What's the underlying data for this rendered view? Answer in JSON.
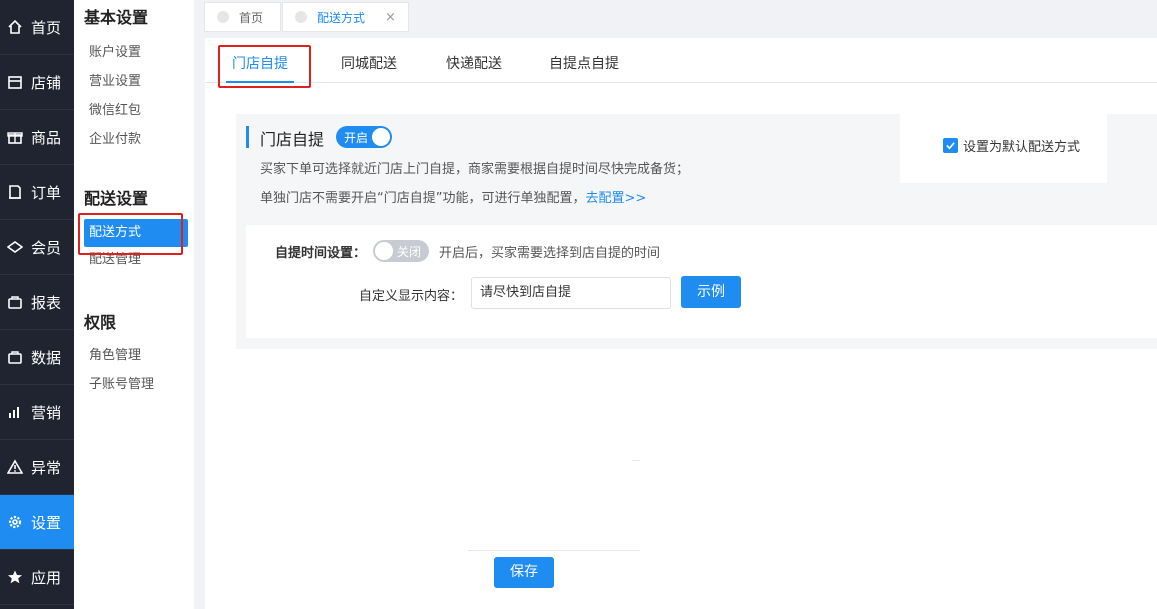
{
  "nav": {
    "items": [
      {
        "label": "首页",
        "icon": "home-icon"
      },
      {
        "label": "店铺",
        "icon": "store-icon"
      },
      {
        "label": "商品",
        "icon": "gift-icon"
      },
      {
        "label": "订单",
        "icon": "order-icon"
      },
      {
        "label": "会员",
        "icon": "member-icon"
      },
      {
        "label": "报表",
        "icon": "report-icon"
      },
      {
        "label": "数据",
        "icon": "data-icon"
      },
      {
        "label": "营销",
        "icon": "marketing-icon"
      },
      {
        "label": "异常",
        "icon": "warning-icon"
      },
      {
        "label": "设置",
        "icon": "gear-icon"
      },
      {
        "label": "应用",
        "icon": "star-icon"
      }
    ],
    "active_index": 9
  },
  "sidebar": {
    "groups": [
      {
        "title": "基本设置",
        "items": [
          "账户设置",
          "营业设置",
          "微信红包",
          "企业付款"
        ]
      },
      {
        "title": "配送设置",
        "items": [
          "配送方式",
          "配送管理"
        ]
      },
      {
        "title": "权限",
        "items": [
          "角色管理",
          "子账号管理"
        ]
      }
    ],
    "active_item": "配送方式"
  },
  "tabs": [
    {
      "label": "首页",
      "closable": false
    },
    {
      "label": "配送方式",
      "closable": true,
      "close_glyph": "×"
    }
  ],
  "subtabs": [
    "门店自提",
    "同城配送",
    "快递配送",
    "自提点自提"
  ],
  "panel": {
    "title": "门店自提",
    "switch_on_label": "开启",
    "desc1": "买家下单可选择就近门店上门自提，商家需要根据自提时间尽快完成备货；",
    "desc2": "单独门店不需要开启“门店自提”功能，可进行单独配置，",
    "desc2_link": "去配置>>",
    "default_checkbox_label": "设置为默认配送方式",
    "default_checked": true,
    "time_setting_label": "自提时间设置：",
    "switch_off_label": "关闭",
    "time_setting_hint": "开启后，买家需要选择到店自提的时间",
    "custom_display_label": "自定义显示内容：",
    "custom_display_value": "请尽快到店自提",
    "example_button": "示例"
  },
  "save_button": "保存",
  "colors": {
    "accent": "#1e8cf0",
    "nav_bg": "#1f2430",
    "highlight": "#e02020"
  }
}
